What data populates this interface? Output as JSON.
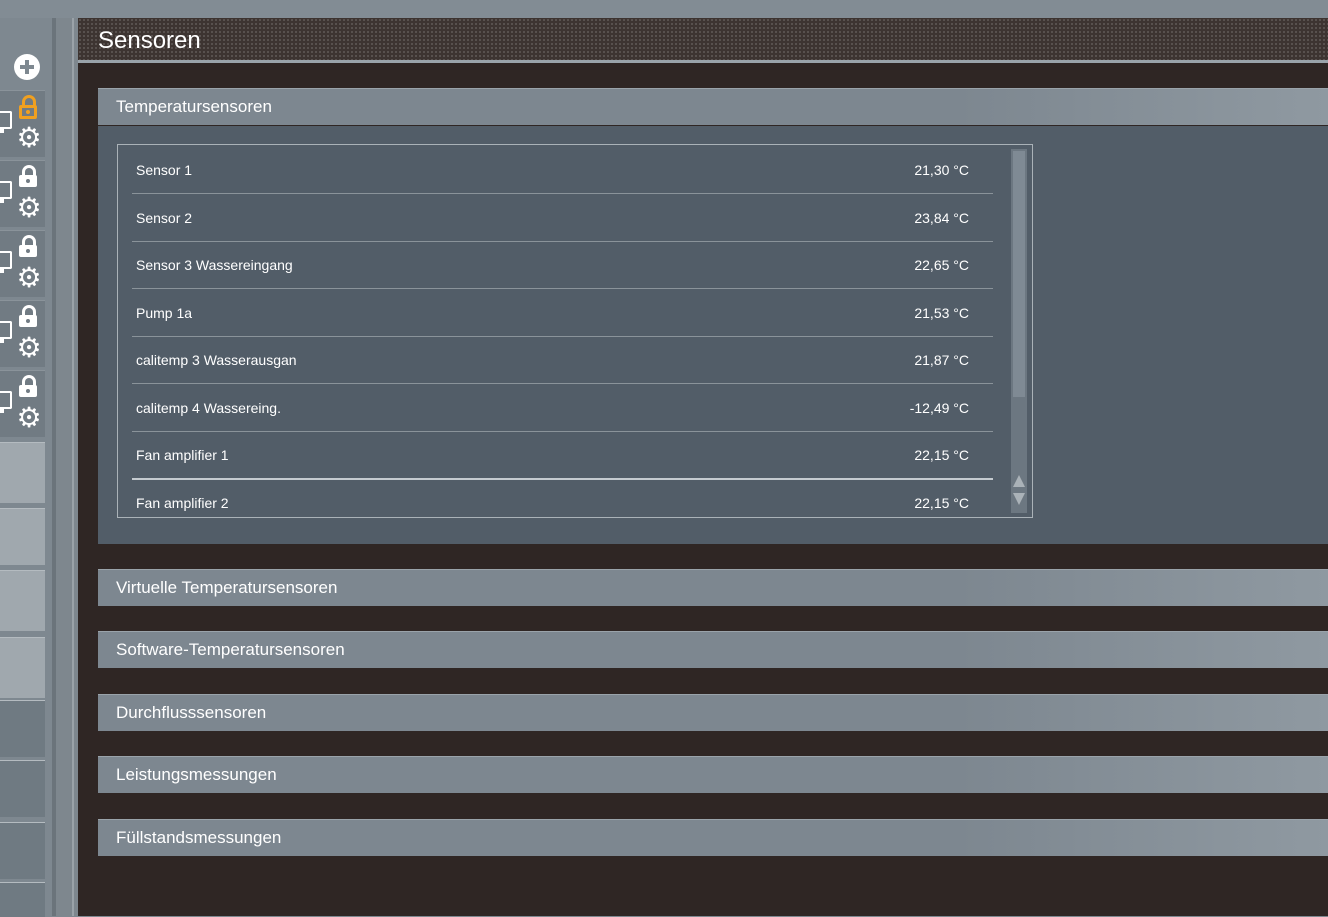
{
  "page": {
    "title": "Sensoren"
  },
  "sections": {
    "temperature": {
      "label": "Temperatursensoren"
    },
    "virtual": {
      "label": "Virtuelle Temperatursensoren"
    },
    "software": {
      "label": "Software-Temperatursensoren"
    },
    "flow": {
      "label": "Durchflusssensoren"
    },
    "power": {
      "label": "Leistungsmessungen"
    },
    "level": {
      "label": "Füllstandsmessungen"
    }
  },
  "sensors": [
    {
      "name": "Sensor 1",
      "value": "21,30 °C"
    },
    {
      "name": "Sensor 2",
      "value": "23,84 °C"
    },
    {
      "name": "Sensor 3 Wassereingang",
      "value": "22,65 °C"
    },
    {
      "name": "Pump 1a",
      "value": "21,53 °C"
    },
    {
      "name": "calitemp 3 Wasserausgan",
      "value": "21,87 °C"
    },
    {
      "name": "calitemp 4 Wassereing.",
      "value": "-12,49 °C"
    },
    {
      "name": "Fan amplifier 1",
      "value": "22,15 °C"
    },
    {
      "name": "Fan amplifier 2",
      "value": "22,15 °C"
    }
  ],
  "sidebar": {
    "icons": {
      "add": "plus-circle-icon",
      "lock_open": "unlocked-icon",
      "lock_closed": "lock-icon",
      "gear": "gear-icon",
      "device": "monitor-icon"
    },
    "devices": [
      {
        "locked": false
      },
      {
        "locked": true
      },
      {
        "locked": true
      },
      {
        "locked": true
      },
      {
        "locked": true
      }
    ]
  },
  "colors": {
    "accent_unlocked": "#f0a020",
    "header_bg": "#3d3431",
    "panel_bg": "#525d68",
    "section_bar": "#7d8790"
  }
}
